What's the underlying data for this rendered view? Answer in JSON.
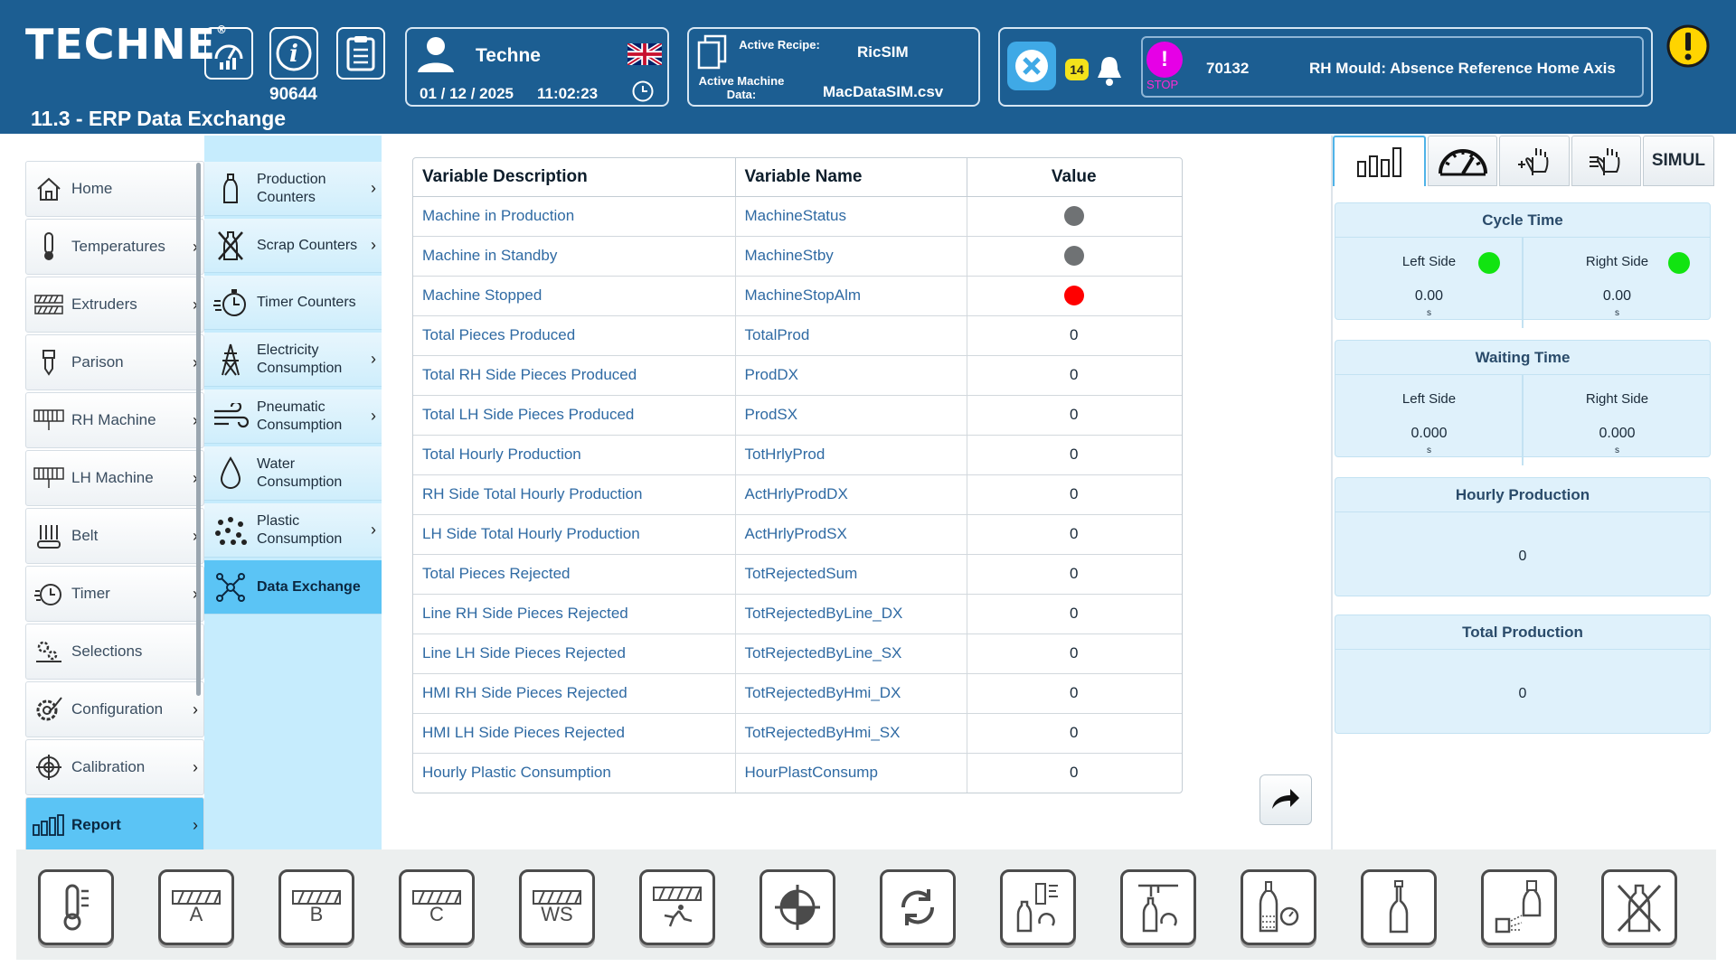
{
  "header": {
    "logo": "TECHNE",
    "logo_mark": "®",
    "counter": "90644",
    "page_title": "11.3 - ERP Data Exchange",
    "user": {
      "name": "Techne",
      "date": "01 / 12 / 2025",
      "time": "11:02:23",
      "flag": "uk-flag-icon"
    },
    "recipe": {
      "active_recipe_label": "Active Recipe:",
      "active_recipe_value": "RicSIM",
      "machine_data_label": "Active Machine Data:",
      "machine_data_value": "MacDataSIM.csv"
    },
    "alarm": {
      "count": "14",
      "stop_label": "STOP",
      "code": "70132",
      "message": "RH Mould: Absence Reference Home Axis"
    }
  },
  "sidebar": {
    "items": [
      {
        "label": "Home",
        "icon": "home-icon"
      },
      {
        "label": "Temperatures",
        "icon": "thermometer-icon"
      },
      {
        "label": "Extruders",
        "icon": "screw-icon"
      },
      {
        "label": "Parison",
        "icon": "parison-icon"
      },
      {
        "label": "RH Machine",
        "icon": "rh-machine-icon"
      },
      {
        "label": "LH Machine",
        "icon": "lh-machine-icon"
      },
      {
        "label": "Belt",
        "icon": "belt-icon"
      },
      {
        "label": "Timer",
        "icon": "timer-icon"
      },
      {
        "label": "Selections",
        "icon": "selections-icon"
      },
      {
        "label": "Configuration",
        "icon": "configuration-icon"
      },
      {
        "label": "Calibration",
        "icon": "calibration-icon"
      },
      {
        "label": "Report",
        "icon": "report-icon"
      }
    ]
  },
  "submenu": {
    "items": [
      {
        "label": "Production Counters"
      },
      {
        "label": "Scrap Counters"
      },
      {
        "label": "Timer Counters"
      },
      {
        "label": "Electricity Consumption"
      },
      {
        "label": "Pneumatic Consumption"
      },
      {
        "label": "Water Consumption"
      },
      {
        "label": "Plastic Consumption"
      },
      {
        "label": "Data Exchange"
      }
    ]
  },
  "table": {
    "headers": {
      "description": "Variable Description",
      "name": "Variable Name",
      "value": "Value"
    },
    "rows": [
      {
        "description": "Machine in Production",
        "name": "MachineStatus",
        "value": "",
        "indicator": "#6f7274"
      },
      {
        "description": "Machine in Standby",
        "name": "MachineStby",
        "value": "",
        "indicator": "#6f7274"
      },
      {
        "description": "Machine Stopped",
        "name": "MachineStopAlm",
        "value": "",
        "indicator": "#ff0000"
      },
      {
        "description": "Total Pieces Produced",
        "name": "TotalProd",
        "value": "0"
      },
      {
        "description": "Total RH Side Pieces Produced",
        "name": "ProdDX",
        "value": "0"
      },
      {
        "description": "Total LH Side Pieces Produced",
        "name": "ProdSX",
        "value": "0"
      },
      {
        "description": "Total Hourly Production",
        "name": "TotHrlyProd",
        "value": "0"
      },
      {
        "description": "RH Side Total Hourly Production",
        "name": "ActHrlyProdDX",
        "value": "0"
      },
      {
        "description": "LH Side Total Hourly Production",
        "name": "ActHrlyProdSX",
        "value": "0"
      },
      {
        "description": "Total Pieces Rejected",
        "name": "TotRejectedSum",
        "value": "0"
      },
      {
        "description": "Line RH Side Pieces Rejected",
        "name": "TotRejectedByLine_DX",
        "value": "0"
      },
      {
        "description": "Line LH Side Pieces Rejected",
        "name": "TotRejectedByLine_SX",
        "value": "0"
      },
      {
        "description": "HMI RH Side Pieces Rejected",
        "name": "TotRejectedByHmi_DX",
        "value": "0"
      },
      {
        "description": "HMI LH Side Pieces Rejected",
        "name": "TotRejectedByHmi_SX",
        "value": "0"
      },
      {
        "description": "Hourly Plastic Consumption",
        "name": "HourPlastConsump",
        "value": "0"
      }
    ]
  },
  "right_panel": {
    "tabs": {
      "simul": "SIMUL"
    },
    "cycle_time": {
      "title": "Cycle Time",
      "left_label": "Left Side",
      "right_label": "Right Side",
      "left_value": "0.00",
      "right_value": "0.00",
      "unit": "s"
    },
    "waiting_time": {
      "title": "Waiting Time",
      "left_label": "Left Side",
      "right_label": "Right Side",
      "left_value": "0.000",
      "right_value": "0.000",
      "unit": "s"
    },
    "hourly_production": {
      "title": "Hourly Production",
      "value": "0"
    },
    "total_production": {
      "title": "Total Production",
      "value": "0"
    }
  },
  "toolbar": {
    "buttons": [
      {
        "icon": "thermometer-icon",
        "letter": ""
      },
      {
        "icon": "extruder-a-icon",
        "letter": "A"
      },
      {
        "icon": "extruder-b-icon",
        "letter": "B"
      },
      {
        "icon": "extruder-c-icon",
        "letter": "C"
      },
      {
        "icon": "extruder-ws-icon",
        "letter": "WS"
      },
      {
        "icon": "extruder-run-icon",
        "letter": ""
      },
      {
        "icon": "crosshair-icon",
        "letter": ""
      },
      {
        "icon": "cycle-icon",
        "letter": ""
      },
      {
        "icon": "bottle-mould-icon",
        "letter": ""
      },
      {
        "icon": "bottle-blow-icon",
        "letter": ""
      },
      {
        "icon": "bottle-gauge-icon",
        "letter": ""
      },
      {
        "icon": "bottle-icon",
        "letter": ""
      },
      {
        "icon": "bottle-spray-icon",
        "letter": ""
      },
      {
        "icon": "bottle-reject-icon",
        "letter": ""
      }
    ]
  }
}
